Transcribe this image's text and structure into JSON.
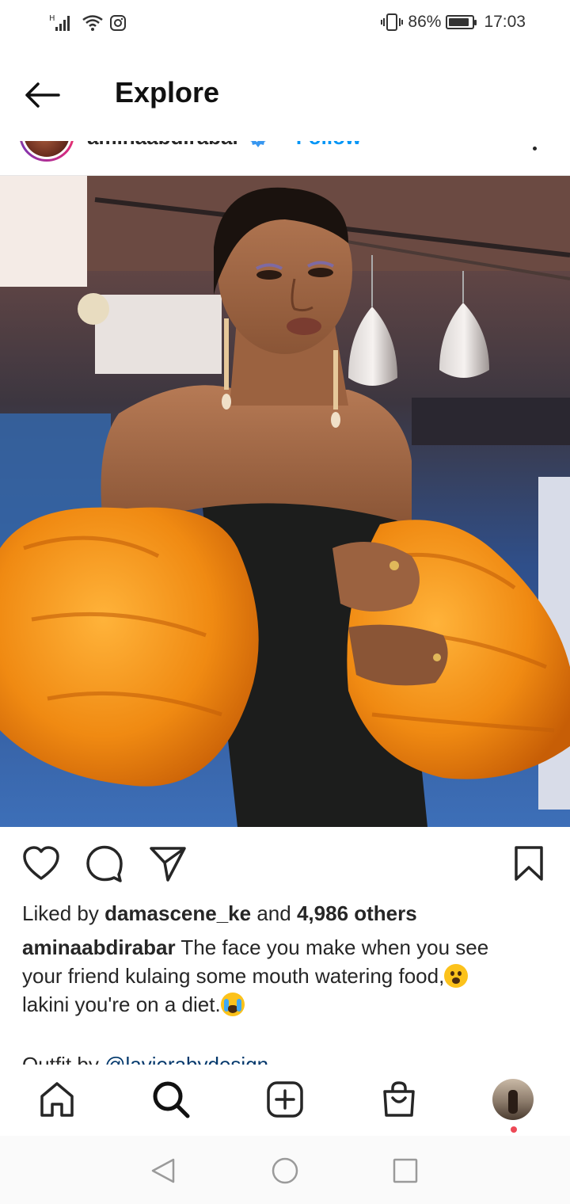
{
  "status_bar": {
    "network": "H",
    "battery_percent": "86%",
    "battery_level": 0.86,
    "time": "17:03"
  },
  "header": {
    "title": "Explore"
  },
  "post": {
    "username": "aminaabdirabar",
    "follow_label": "· Follow",
    "likes": {
      "prefix": "Liked by",
      "liker": "damascene_ke",
      "joiner": "and",
      "others": "4,986 others"
    },
    "caption": {
      "username": "aminaabdirabar",
      "text_part1": "The face you make when you see your friend kulaing some mouth watering food,",
      "text_part2": "lakini you're on a diet."
    },
    "outfit": {
      "prefix": "Outfit by",
      "mention": "@lavierabydesign"
    }
  },
  "colors": {
    "link_blue": "#0095f6",
    "mention_blue": "#00376b",
    "notification_red": "#ed4956",
    "dress_orange": "#f08a12"
  },
  "icons": {
    "actions": [
      "heart-icon",
      "comment-icon",
      "share-icon",
      "bookmark-icon"
    ],
    "bottom_nav": [
      "home-icon",
      "search-icon",
      "new-post-icon",
      "shop-icon",
      "profile-avatar"
    ]
  }
}
